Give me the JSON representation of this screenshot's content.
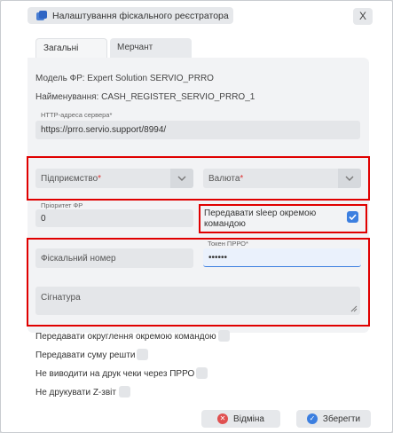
{
  "dialog": {
    "title": "Налаштування фіскального реєстратора",
    "close": "X"
  },
  "tabs": [
    {
      "label": "Загальні",
      "active": true
    },
    {
      "label": "Мерчант",
      "active": false
    }
  ],
  "info": {
    "model": "Модель ФР: Expert Solution SERVIO_PRRO",
    "name": "Найменування: CASH_REGISTER_SERVIO_PRRO_1"
  },
  "server": {
    "label": "HTTP-адреса сервера*",
    "value": "https://prro.servio.support/8994/"
  },
  "company": {
    "placeholder": "Підприємство",
    "required": "*"
  },
  "currency": {
    "placeholder": "Валюта",
    "required": "*"
  },
  "priority": {
    "label": "Пріоритет ФР",
    "value": "0"
  },
  "sleep": {
    "label": "Передавати sleep окремою командою",
    "checked": true
  },
  "fiscal_number": {
    "placeholder": "Фіскальний номер"
  },
  "token": {
    "label": "Токен ПРРО*",
    "value": "••••••"
  },
  "signature": {
    "placeholder": "Сігнатура"
  },
  "checkboxes": [
    {
      "label": "Передавати округлення окремою командою",
      "checked": false
    },
    {
      "label": "Передавати суму решти",
      "checked": false
    },
    {
      "label": "Не виводити на друк чеки через ПРРО",
      "checked": false
    },
    {
      "label": "Не друкувати Z-звіт",
      "checked": false
    }
  ],
  "buttons": {
    "cancel": "Відміна",
    "save": "Зберегти"
  },
  "colors": {
    "accent": "#3c7fe0",
    "highlight": "#e00000",
    "cancel_icon": "#e05050"
  }
}
